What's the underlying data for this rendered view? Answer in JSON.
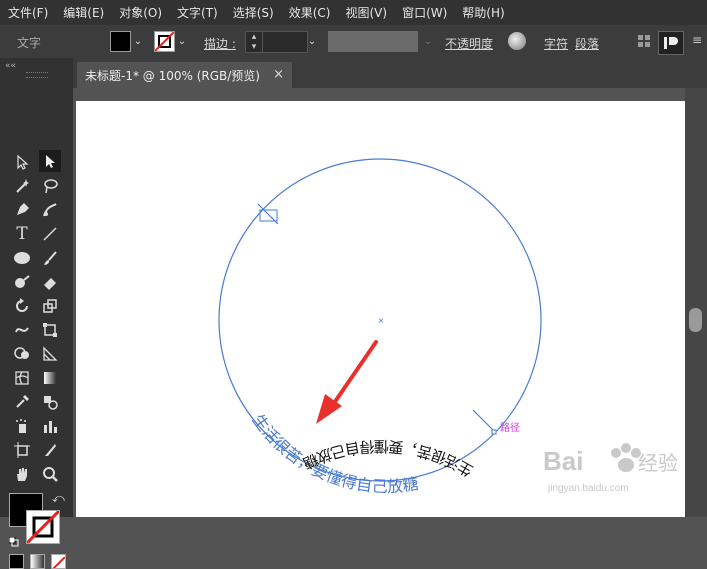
{
  "menu": [
    "文件(F)",
    "编辑(E)",
    "对象(O)",
    "文字(T)",
    "选择(S)",
    "效果(C)",
    "视图(V)",
    "窗口(W)",
    "帮助(H)"
  ],
  "control": {
    "tool_label": "文字",
    "stroke_label": "描边 :",
    "opacity_label": "不透明度",
    "char_label": "字符",
    "para_label": "段落"
  },
  "tab": {
    "title": "未标题-1* @ 100% (RGB/预览)",
    "close": "×"
  },
  "canvas": {
    "text_blue": "生活很苦，要懂得自己放糖",
    "text_black": "生活很苦，要懂得自己放糖",
    "path_label": "路径"
  },
  "icons": [
    "direct-selection-icon",
    "selection-icon",
    "magic-wand-icon",
    "lasso-icon",
    "pen-icon",
    "curvature-icon",
    "type-icon",
    "line-icon",
    "ellipse-icon",
    "paintbrush-icon",
    "blob-brush-icon",
    "eraser-icon",
    "rotate-icon",
    "scale-icon",
    "warp-icon",
    "free-transform-icon",
    "shape-builder-icon",
    "perspective-grid-icon",
    "mesh-icon",
    "gradient-icon",
    "eyedropper-icon",
    "blend-icon",
    "symbol-sprayer-icon",
    "column-graph-icon",
    "artboard-icon",
    "slice-icon",
    "hand-icon",
    "zoom-icon"
  ],
  "colors": {
    "path": "#4a7bd0",
    "arrow": "#e8302c",
    "path_label": "#d63be0"
  }
}
